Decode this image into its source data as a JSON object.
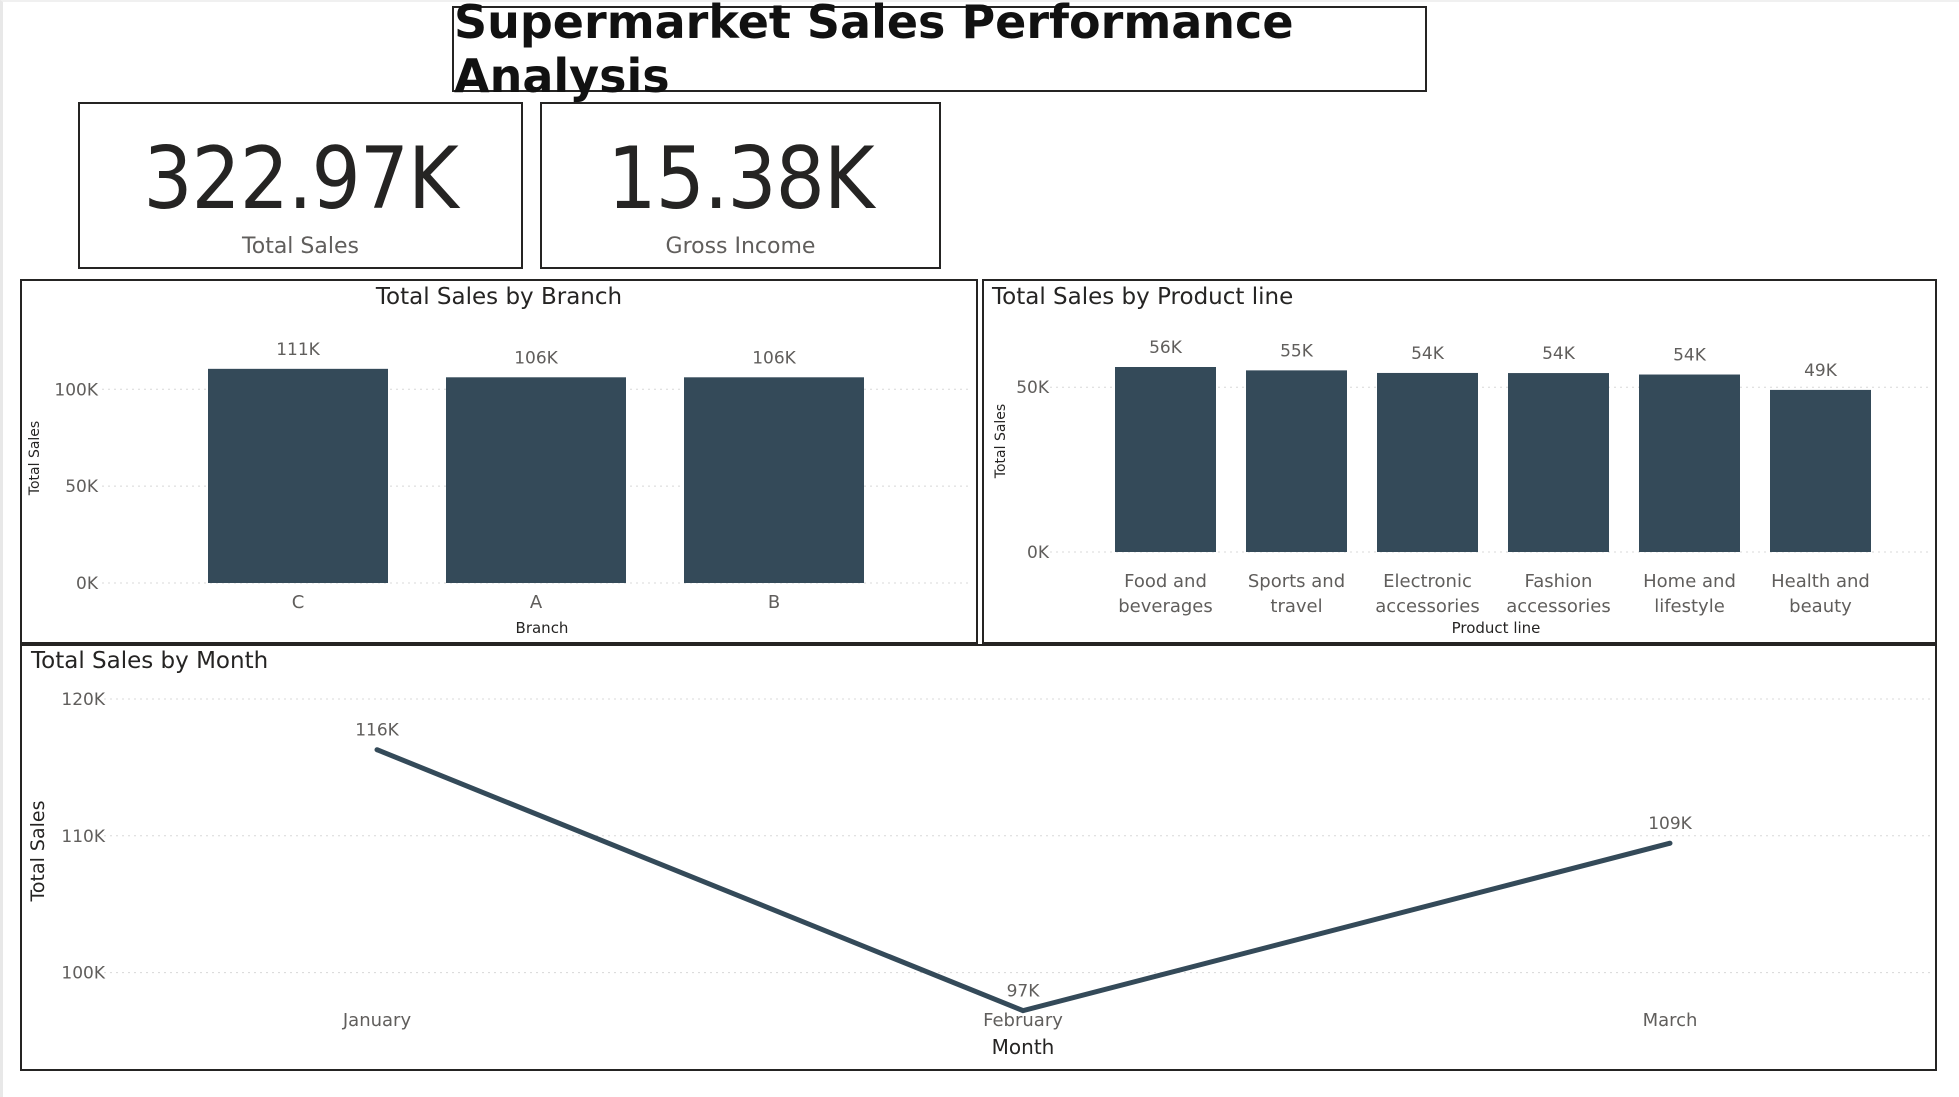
{
  "title": "Supermarket Sales Performance Analysis",
  "kpis": [
    {
      "value": "322.97K",
      "label": "Total Sales"
    },
    {
      "value": "15.38K",
      "label": "Gross Income"
    }
  ],
  "colors": {
    "bar": "#344a59",
    "line": "#344a59",
    "grid": "#d8d8d8",
    "text": "#605e5c"
  },
  "chart_data": [
    {
      "type": "bar",
      "title": "Total Sales by Branch",
      "xlabel": "Branch",
      "ylabel": "Total Sales",
      "categories": [
        "C",
        "A",
        "B"
      ],
      "values": [
        110568,
        106198,
        106197
      ],
      "data_labels": [
        "111K",
        "106K",
        "106K"
      ],
      "yticks": [
        0,
        50000,
        100000
      ],
      "ytick_labels": [
        "0K",
        "50K",
        "100K"
      ],
      "ylim": [
        0,
        111000
      ],
      "grid": true
    },
    {
      "type": "bar",
      "title": "Total Sales by Product line",
      "xlabel": "Product line",
      "ylabel": "Total Sales",
      "categories": [
        [
          "Food and",
          "beverages"
        ],
        [
          "Sports and",
          "travel"
        ],
        [
          "Electronic",
          "accessories"
        ],
        [
          "Fashion",
          "accessories"
        ],
        [
          "Home and",
          "lifestyle"
        ],
        [
          "Health and",
          "beauty"
        ]
      ],
      "values": [
        56145,
        55123,
        54338,
        54306,
        53862,
        49194
      ],
      "data_labels": [
        "56K",
        "55K",
        "54K",
        "54K",
        "54K",
        "49K"
      ],
      "yticks": [
        0,
        50000
      ],
      "ytick_labels": [
        "0K",
        "50K"
      ],
      "ylim": [
        0,
        56145
      ],
      "grid": true
    },
    {
      "type": "line",
      "title": "Total Sales by Month",
      "xlabel": "Month",
      "ylabel": "Total Sales",
      "categories": [
        "January",
        "February",
        "March"
      ],
      "values": [
        116292,
        97219,
        109456
      ],
      "data_labels": [
        "116K",
        "97K",
        "109K"
      ],
      "yticks": [
        100000,
        110000,
        120000
      ],
      "ytick_labels": [
        "100K",
        "110K",
        "120K"
      ],
      "ylim": [
        92000,
        120000
      ],
      "grid": true
    }
  ]
}
